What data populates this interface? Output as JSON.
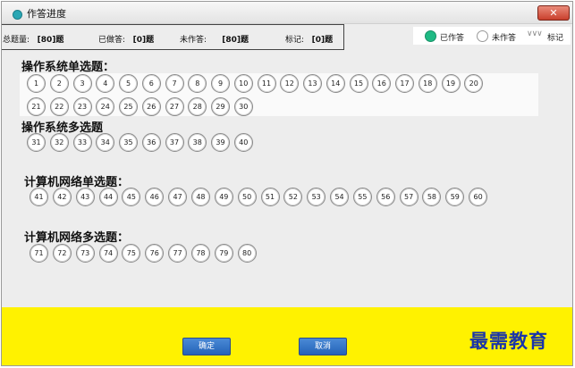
{
  "window": {
    "title": "作答进度",
    "close_icon": "✕"
  },
  "stats": [
    {
      "label": "总题量:",
      "value": "[80]题"
    },
    {
      "label": "已做答:",
      "value": "[0]题"
    },
    {
      "label": "未作答:",
      "value": "[80]题"
    },
    {
      "label": "标记:",
      "value": "[0]题"
    }
  ],
  "legend": {
    "done": "已作答",
    "todo": "未作答",
    "mark_symbol": "∨∨∨",
    "mark": "标记",
    "done_color": "#1fba84"
  },
  "sections": [
    {
      "title": "操作系统单选题：",
      "numbers": [
        "1",
        "2",
        "3",
        "4",
        "5",
        "6",
        "7",
        "8",
        "9",
        "10",
        "11",
        "12",
        "13",
        "14",
        "15",
        "16",
        "17",
        "18",
        "19",
        "20",
        "21",
        "22",
        "23",
        "24",
        "25",
        "26",
        "27",
        "28",
        "29",
        "30"
      ]
    },
    {
      "title": "操作系统多选题",
      "numbers": [
        "31",
        "32",
        "33",
        "34",
        "35",
        "36",
        "37",
        "38",
        "39",
        "40"
      ]
    },
    {
      "title": "计算机网络单选题：",
      "numbers": [
        "41",
        "42",
        "43",
        "44",
        "45",
        "46",
        "47",
        "48",
        "49",
        "50",
        "51",
        "52",
        "53",
        "54",
        "55",
        "56",
        "57",
        "58",
        "59",
        "60"
      ]
    },
    {
      "title": "计算机网络多选题：",
      "numbers": [
        "71",
        "72",
        "73",
        "74",
        "75",
        "76",
        "77",
        "78",
        "79",
        "80"
      ]
    }
  ],
  "buttons": {
    "ok": "确定",
    "cancel": "取消"
  },
  "watermark": "最需教育",
  "colors": {
    "footer": "#fff200",
    "button": "#2563b8"
  }
}
